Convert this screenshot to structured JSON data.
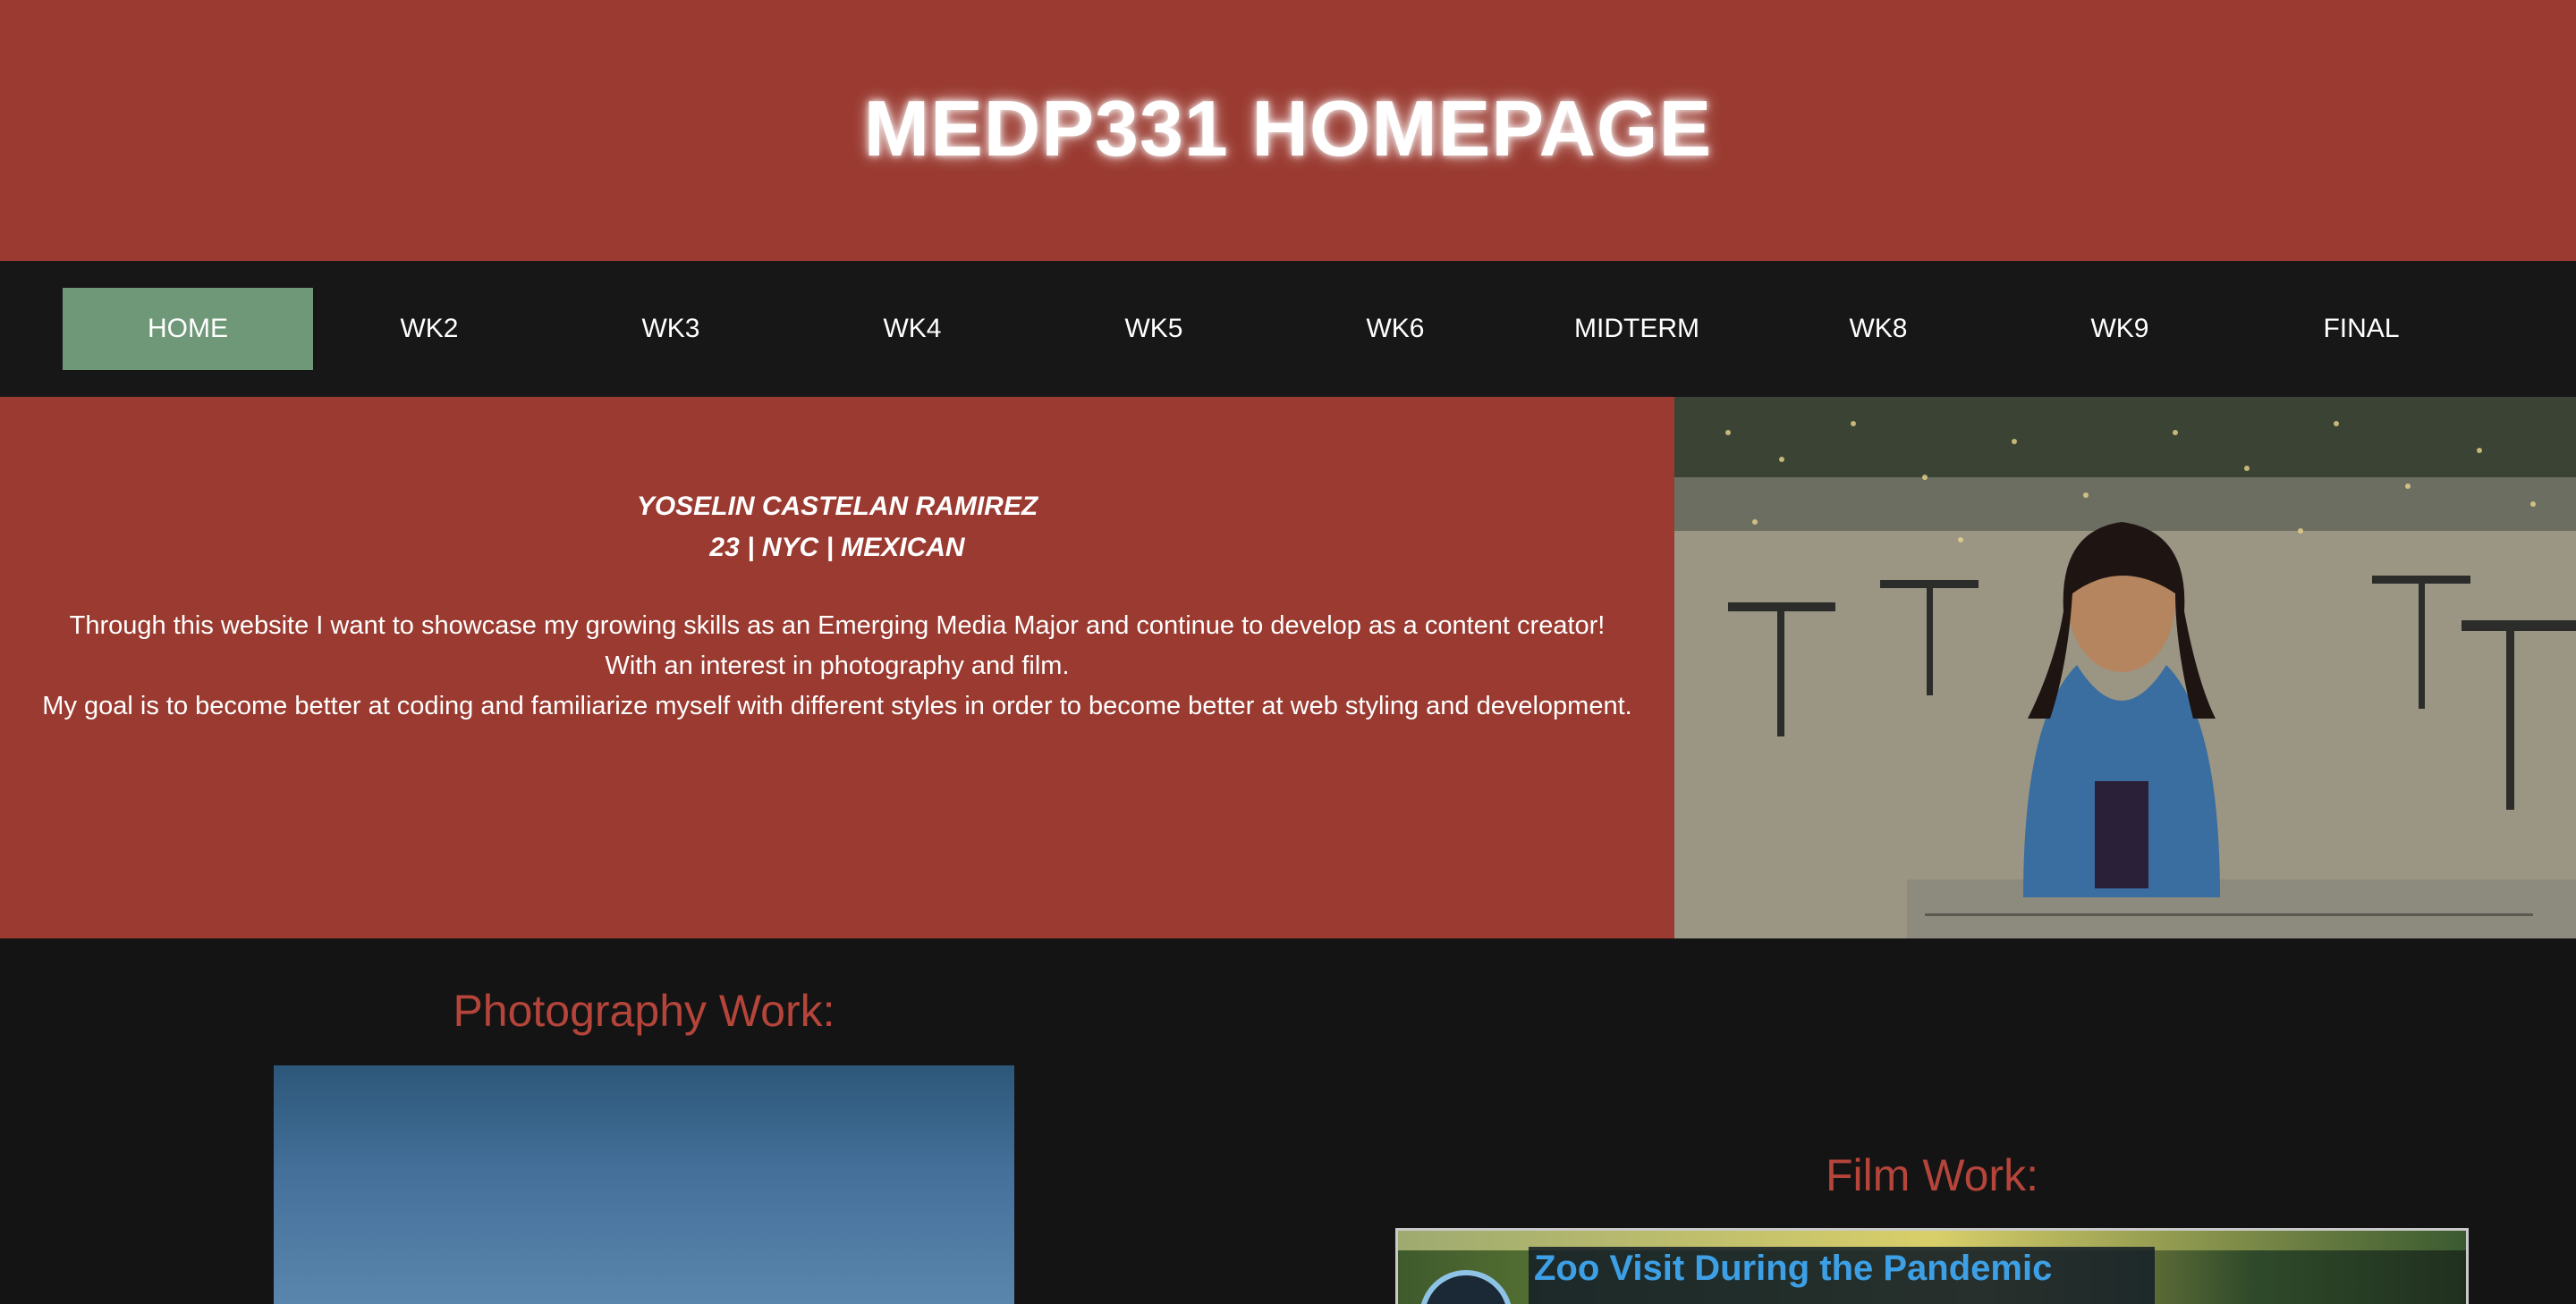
{
  "header": {
    "title": "MEDP331 HOMEPAGE"
  },
  "nav": {
    "items": [
      {
        "label": "HOME",
        "active": true
      },
      {
        "label": "WK2",
        "active": false
      },
      {
        "label": "WK3",
        "active": false
      },
      {
        "label": "WK4",
        "active": false
      },
      {
        "label": "WK5",
        "active": false
      },
      {
        "label": "WK6",
        "active": false
      },
      {
        "label": "MIDTERM",
        "active": false
      },
      {
        "label": "WK8",
        "active": false
      },
      {
        "label": "WK9",
        "active": false
      },
      {
        "label": "FINAL",
        "active": false
      }
    ]
  },
  "intro": {
    "name": "YOSELIN CASTELAN RAMIREZ",
    "tagline": "23 | NYC | MEXICAN",
    "bio": [
      "Through this website I want to showcase my growing skills as an Emerging Media Major and continue to develop as a content creator!",
      "With an interest in photography and film.",
      "My goal is to become better at coding and familiarize myself with different styles in order to become better at web styling and development."
    ]
  },
  "sections": {
    "photography_title": "Photography Work:",
    "film_title": "Film Work:",
    "video_title": "Zoo Visit During the Pandemic"
  },
  "colors": {
    "header_bg": "#9a3a30",
    "nav_bg": "#171717",
    "active_nav": "#6f9878",
    "accent_text": "#b5453a",
    "page_bg": "#141414"
  }
}
